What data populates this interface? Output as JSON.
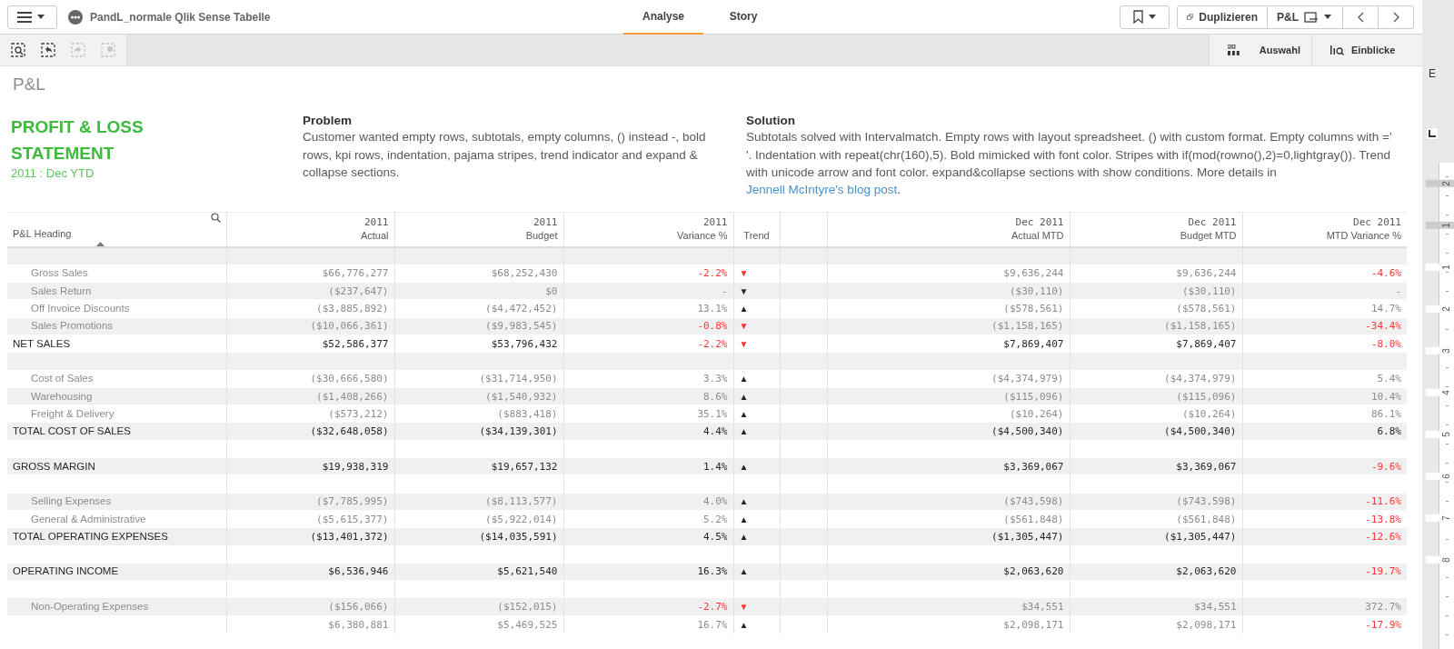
{
  "app_bar": {
    "title": "PandL_normale Qlik Sense Tabelle",
    "tabs": [
      {
        "label": "Analyse",
        "selected": true
      },
      {
        "label": "Story",
        "selected": false
      }
    ],
    "duplicate_button": "Duplizieren",
    "sheet_button": "P&L"
  },
  "toolbar": {
    "tools": [
      {
        "kind": "search",
        "disabled": false
      },
      {
        "kind": "back",
        "disabled": false
      },
      {
        "kind": "forward",
        "disabled": true
      },
      {
        "kind": "clear",
        "disabled": true
      }
    ],
    "selections_button": "Auswahl",
    "insights_button": "Einblicke"
  },
  "sheet_title": "P&L",
  "statement": {
    "title": "PROFIT & LOSS STATEMENT",
    "period": "2011 : Dec YTD"
  },
  "problem": {
    "heading": "Problem",
    "text": "Customer wanted empty rows, subtotals, empty columns, () instead -, bold rows, kpi rows, indentation, pajama stripes, trend indicator and expand & collapse sections."
  },
  "solution": {
    "heading": "Solution",
    "text": "Subtotals solved with Intervalmatch. Empty rows with layout spreadsheet. () with custom format. Empty columns with =' '. Indentation with repeat(chr(160),5). Bold mimicked with font color. Stripes with if(mod(rowno(),2)=0,lightgray()). Trend with unicode arrow and font color. expand&collapse sections with show conditions. More details in ",
    "link": "Jennell McIntyre's blog post",
    "tail": "."
  },
  "table": {
    "columns": [
      {
        "kind": "heading",
        "label": "P&L Heading"
      },
      {
        "kind": "value",
        "year": "2011",
        "label": "Actual"
      },
      {
        "kind": "value",
        "year": "2011",
        "label": "Budget"
      },
      {
        "kind": "value",
        "year": "2011",
        "label": "Variance %"
      },
      {
        "kind": "trend",
        "label": "Trend"
      },
      {
        "kind": "spacer"
      },
      {
        "kind": "value",
        "year": "Dec 2011",
        "label": "Actual MTD"
      },
      {
        "kind": "value",
        "year": "Dec 2011",
        "label": "Budget MTD"
      },
      {
        "kind": "value",
        "year": "Dec 2011",
        "label": "MTD Variance %"
      }
    ],
    "rows": [
      {
        "kind": "blank"
      },
      {
        "kind": "detail",
        "label": "Gross Sales",
        "actual": "$66,776,277",
        "budget": "$68,252,430",
        "variance": "-2.2%",
        "variance_alert": true,
        "trend": "▼",
        "trend_alert": true,
        "mtd_actual": "$9,636,244",
        "mtd_budget": "$9,636,244",
        "mtd_variance": "-4.6%",
        "mtd_alert": true
      },
      {
        "kind": "detail",
        "label": "Sales Return",
        "actual": "($237,647)",
        "budget": "$0",
        "variance": "-",
        "variance_alert": false,
        "trend": "▼",
        "trend_alert": false,
        "mtd_actual": "($30,110)",
        "mtd_budget": "($30,110)",
        "mtd_variance": "-",
        "mtd_alert": false
      },
      {
        "kind": "detail",
        "label": "Off Invoice Discounts",
        "actual": "($3,885,892)",
        "budget": "($4,472,452)",
        "variance": "13.1%",
        "variance_alert": false,
        "trend": "▲",
        "trend_alert": false,
        "mtd_actual": "($578,561)",
        "mtd_budget": "($578,561)",
        "mtd_variance": "14.7%",
        "mtd_alert": false
      },
      {
        "kind": "detail",
        "label": "Sales Promotions",
        "actual": "($10,066,361)",
        "budget": "($9,983,545)",
        "variance": "-0.8%",
        "variance_alert": true,
        "trend": "▼",
        "trend_alert": true,
        "mtd_actual": "($1,158,165)",
        "mtd_budget": "($1,158,165)",
        "mtd_variance": "-34.4%",
        "mtd_alert": true
      },
      {
        "kind": "total",
        "label": "NET SALES",
        "actual": "$52,586,377",
        "budget": "$53,796,432",
        "variance": "-2.2%",
        "variance_alert": true,
        "trend": "▼",
        "trend_alert": true,
        "mtd_actual": "$7,869,407",
        "mtd_budget": "$7,869,407",
        "mtd_variance": "-8.0%",
        "mtd_alert": true
      },
      {
        "kind": "blank"
      },
      {
        "kind": "detail",
        "label": "Cost of Sales",
        "actual": "($30,666,580)",
        "budget": "($31,714,950)",
        "variance": "3.3%",
        "variance_alert": false,
        "trend": "▲",
        "trend_alert": false,
        "mtd_actual": "($4,374,979)",
        "mtd_budget": "($4,374,979)",
        "mtd_variance": "5.4%",
        "mtd_alert": false
      },
      {
        "kind": "detail",
        "label": "Warehousing",
        "actual": "($1,408,266)",
        "budget": "($1,540,932)",
        "variance": "8.6%",
        "variance_alert": false,
        "trend": "▲",
        "trend_alert": false,
        "mtd_actual": "($115,096)",
        "mtd_budget": "($115,096)",
        "mtd_variance": "10.4%",
        "mtd_alert": false
      },
      {
        "kind": "detail",
        "label": "Freight & Delivery",
        "actual": "($573,212)",
        "budget": "($883,418)",
        "variance": "35.1%",
        "variance_alert": false,
        "trend": "▲",
        "trend_alert": false,
        "mtd_actual": "($10,264)",
        "mtd_budget": "($10,264)",
        "mtd_variance": "86.1%",
        "mtd_alert": false
      },
      {
        "kind": "total",
        "label": "TOTAL COST OF SALES",
        "actual": "($32,648,058)",
        "budget": "($34,139,301)",
        "variance": "4.4%",
        "variance_alert": false,
        "trend": "▲",
        "trend_alert": false,
        "mtd_actual": "($4,500,340)",
        "mtd_budget": "($4,500,340)",
        "mtd_variance": "6.8%",
        "mtd_alert": false
      },
      {
        "kind": "blank"
      },
      {
        "kind": "total",
        "label": "GROSS MARGIN",
        "actual": "$19,938,319",
        "budget": "$19,657,132",
        "variance": "1.4%",
        "variance_alert": false,
        "trend": "▲",
        "trend_alert": false,
        "mtd_actual": "$3,369,067",
        "mtd_budget": "$3,369,067",
        "mtd_variance": "-9.6%",
        "mtd_alert": true
      },
      {
        "kind": "blank"
      },
      {
        "kind": "detail",
        "label": "Selling Expenses",
        "actual": "($7,785,995)",
        "budget": "($8,113,577)",
        "variance": "4.0%",
        "variance_alert": false,
        "trend": "▲",
        "trend_alert": false,
        "mtd_actual": "($743,598)",
        "mtd_budget": "($743,598)",
        "mtd_variance": "-11.6%",
        "mtd_alert": true
      },
      {
        "kind": "detail",
        "label": "General & Administrative",
        "actual": "($5,615,377)",
        "budget": "($5,922,014)",
        "variance": "5.2%",
        "variance_alert": false,
        "trend": "▲",
        "trend_alert": false,
        "mtd_actual": "($561,848)",
        "mtd_budget": "($561,848)",
        "mtd_variance": "-13.8%",
        "mtd_alert": true
      },
      {
        "kind": "total",
        "label": "TOTAL OPERATING EXPENSES",
        "actual": "($13,401,372)",
        "budget": "($14,035,591)",
        "variance": "4.5%",
        "variance_alert": false,
        "trend": "▲",
        "trend_alert": false,
        "mtd_actual": "($1,305,447)",
        "mtd_budget": "($1,305,447)",
        "mtd_variance": "-12.6%",
        "mtd_alert": true
      },
      {
        "kind": "blank"
      },
      {
        "kind": "total",
        "label": "OPERATING INCOME",
        "actual": "$6,536,946",
        "budget": "$5,621,540",
        "variance": "16.3%",
        "variance_alert": false,
        "trend": "▲",
        "trend_alert": false,
        "mtd_actual": "$2,063,620",
        "mtd_budget": "$2,063,620",
        "mtd_variance": "-19.7%",
        "mtd_alert": true
      },
      {
        "kind": "blank"
      },
      {
        "kind": "detail",
        "label": "Non-Operating Expenses",
        "actual": "($156,066)",
        "budget": "($152,015)",
        "variance": "-2.7%",
        "variance_alert": true,
        "trend": "▼",
        "trend_alert": true,
        "mtd_actual": "$34,551",
        "mtd_budget": "$34,551",
        "mtd_variance": "372.7%",
        "mtd_alert": false
      },
      {
        "kind": "detail",
        "actual": "$6,380,881",
        "budget": "$5,469,525",
        "variance": "16.7%",
        "variance_alert": false,
        "trend": "▲",
        "trend_alert": false,
        "mtd_actual": "$2,098,171",
        "mtd_budget": "$2,098,171",
        "mtd_variance": "-17.9%",
        "mtd_alert": true
      }
    ]
  },
  "side_strip": {
    "letter": "E",
    "ruler_labels": [
      "2",
      "1",
      "1",
      "2",
      "3",
      "4",
      "5",
      "6",
      "7",
      "8"
    ]
  }
}
